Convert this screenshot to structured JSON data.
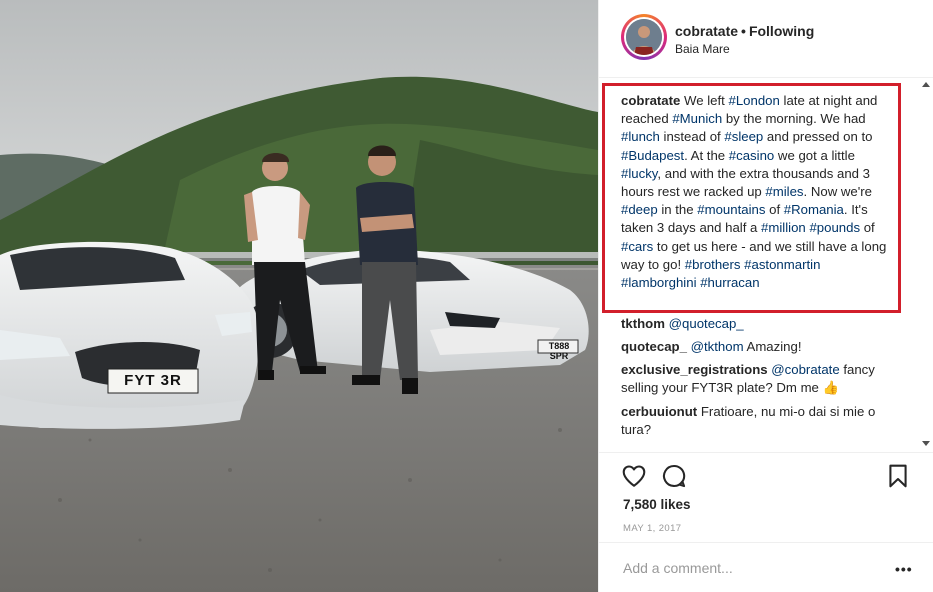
{
  "post": {
    "username": "cobratate",
    "separator": "•",
    "follow_label": "Following",
    "location": "Baia Mare"
  },
  "caption": {
    "username": "cobratate",
    "parts": [
      {
        "t": " We left "
      },
      {
        "tag": "#London"
      },
      {
        "t": " late at night and reached "
      },
      {
        "tag": "#Munich"
      },
      {
        "t": " by the morning. We had "
      },
      {
        "tag": "#lunch"
      },
      {
        "t": " instead of "
      },
      {
        "tag": "#sleep"
      },
      {
        "t": " and pressed on to "
      },
      {
        "tag": "#Budapest"
      },
      {
        "t": ". At the "
      },
      {
        "tag": "#casino"
      },
      {
        "t": " we got a little "
      },
      {
        "tag": "#lucky"
      },
      {
        "t": ", and with the extra thousands and 3 hours rest we racked up "
      },
      {
        "tag": "#miles"
      },
      {
        "t": ". Now we're "
      },
      {
        "tag": "#deep"
      },
      {
        "t": " in the "
      },
      {
        "tag": "#mountains"
      },
      {
        "t": " of "
      },
      {
        "tag": "#Romania"
      },
      {
        "t": ". It's taken 3 days and half a "
      },
      {
        "tag": "#million"
      },
      {
        "t": " "
      },
      {
        "tag": "#pounds"
      },
      {
        "t": " of "
      },
      {
        "tag": "#cars"
      },
      {
        "t": " to get us here - and we still have a long way to go! "
      },
      {
        "tag": "#brothers"
      },
      {
        "t": " "
      },
      {
        "tag": "#astonmartin"
      },
      {
        "t": " "
      },
      {
        "tag": "#lamborghini"
      },
      {
        "t": " "
      },
      {
        "tag": "#hurracan"
      }
    ]
  },
  "comments": [
    {
      "user": "tkthom",
      "mention": "@quotecap_",
      "text": ""
    },
    {
      "user": "quotecap_",
      "mention": "@tkthom",
      "text": " Amazing!"
    },
    {
      "user": "exclusive_registrations",
      "mention": "@cobratate",
      "text": " fancy selling your FYT3R plate? Dm me 👍"
    },
    {
      "user": "cerbuuionut",
      "mention": "",
      "text": "Fratioare, nu mi-o dai si mie o tura?"
    }
  ],
  "likes": "7,580 likes",
  "date": "MAY 1, 2017",
  "comment_placeholder": "Add a comment...",
  "more_label": "•••",
  "photo": {
    "plate_left": "FYT 3R",
    "plate_right": "T888 SPR"
  },
  "icons": [
    "heart-icon",
    "comment-icon",
    "bookmark-icon",
    "scroll-up-icon",
    "scroll-down-icon"
  ],
  "colors": {
    "highlight_box": "#d21f2b",
    "hashtag": "#003569",
    "meta_gray": "#999999"
  }
}
